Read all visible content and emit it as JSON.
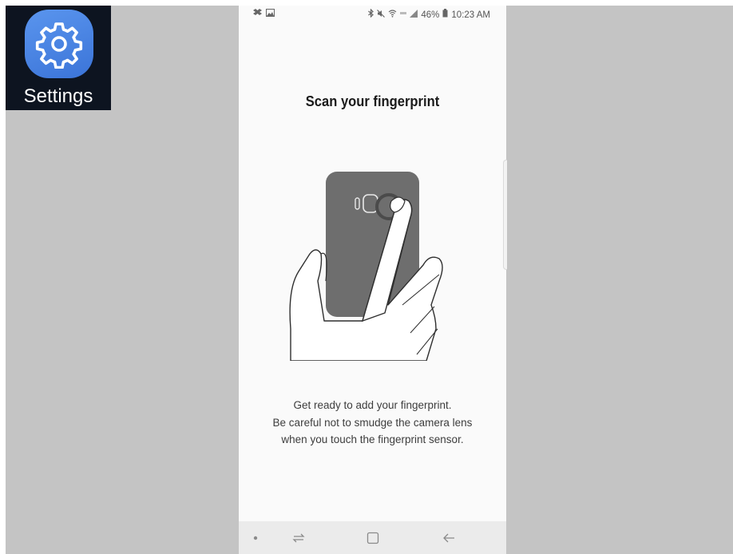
{
  "overlay": {
    "app_name": "Settings",
    "app_icon": "gear-icon",
    "app_icon_color": "#4a86e8"
  },
  "status_bar": {
    "left_icons": [
      "dropbox-icon",
      "image-icon"
    ],
    "right_icons": [
      "bluetooth-icon",
      "mute-icon",
      "wifi-icon",
      "lte-icon",
      "signal-icon"
    ],
    "battery_percent": "46%",
    "battery_icon": "battery-icon",
    "time": "10:23 AM"
  },
  "screen": {
    "title": "Scan your fingerprint",
    "illustration": "hand-touching-phone-fingerprint-sensor",
    "instructions": [
      "Get ready to add your fingerprint.",
      "Be careful not to smudge the camera lens",
      "when you touch the fingerprint sensor."
    ]
  },
  "nav_bar": {
    "buttons": [
      "dot-indicator-icon",
      "recent-apps-icon",
      "home-icon",
      "back-icon"
    ]
  },
  "colors": {
    "background_frame": "#c4c4c4",
    "screen_bg": "#fafafa",
    "nav_bar_bg": "#ebebeb",
    "phone_illustration": "#6e6e6e"
  }
}
